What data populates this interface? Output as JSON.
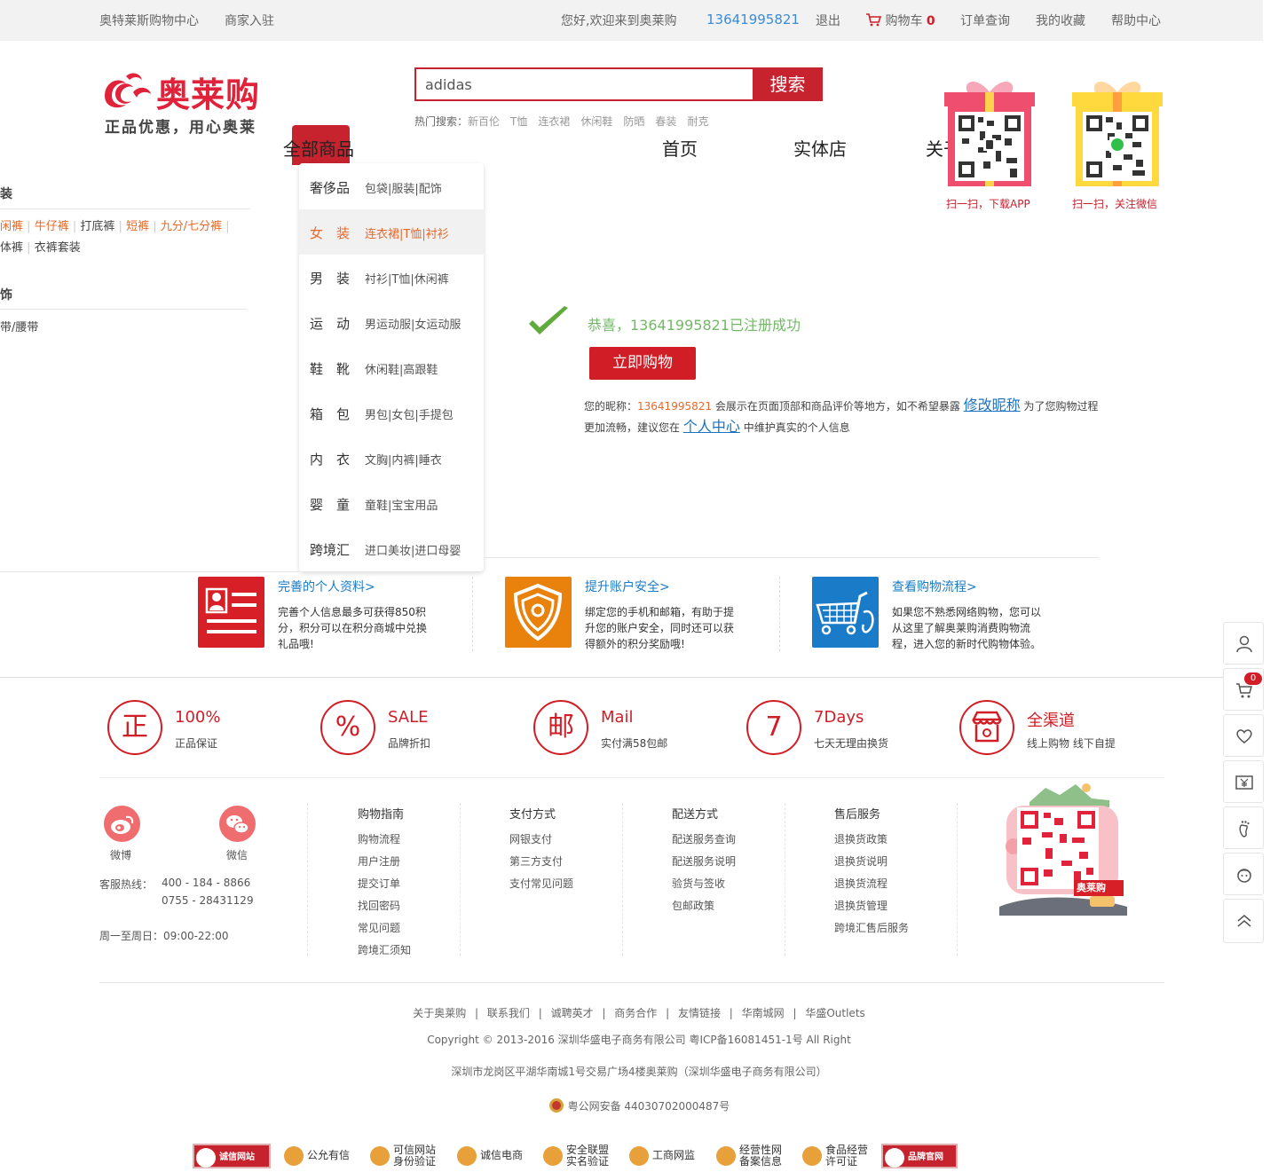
{
  "topbar": {
    "mall_center": "奥特莱斯购物中心",
    "merchant_join": "商家入驻",
    "welcome": "您好,欢迎来到奥莱购",
    "phone": "13641995821",
    "logout": "退出",
    "cart": "购物车",
    "cart_count": "0",
    "order_query": "订单查询",
    "favorites": "我的收藏",
    "help": "帮助中心"
  },
  "header": {
    "logo_text": "奥莱购",
    "slogan": "正品优惠，用心奥莱",
    "search_value": "adidas",
    "search_button": "搜索",
    "hot_label": "热门搜索：",
    "hot_terms": [
      "新百伦",
      "T恤",
      "连衣裙",
      "休闲鞋",
      "防晒",
      "春装",
      "耐克"
    ],
    "qr_app_caption": "扫一扫，下载APP",
    "qr_wechat_caption": "扫一扫，关注微信"
  },
  "nav": {
    "all_goods": "全部商品",
    "home": "首页",
    "stores": "实体店",
    "about": "关于我们"
  },
  "categories": [
    {
      "name": "奢侈品",
      "sub": "包袋|服装|配饰",
      "active": false
    },
    {
      "name": "女　装",
      "sub": "连衣裙|T恤|衬衫",
      "active": true
    },
    {
      "name": "男　装",
      "sub": "衬衫|T恤|休闲裤",
      "active": false
    },
    {
      "name": "运　动",
      "sub": "男运动服|女运动服",
      "active": false
    },
    {
      "name": "鞋　靴",
      "sub": "休闲鞋|高跟鞋",
      "active": false
    },
    {
      "name": "箱　包",
      "sub": "男包|女包|手提包",
      "active": false
    },
    {
      "name": "内　衣",
      "sub": "文胸|内裤|睡衣",
      "active": false
    },
    {
      "name": "婴　童",
      "sub": "童鞋|宝宝用品",
      "active": false
    },
    {
      "name": "跨境汇",
      "sub": "进口美妆|进口母婴",
      "active": false
    }
  ],
  "left_fragments": {
    "heading1": "装",
    "row1": [
      "闲裤",
      "牛仔裤",
      "打底裤",
      "短裤",
      "九分/七分裤"
    ],
    "row2": [
      "体裤",
      "衣裤套装"
    ],
    "heading2": "饰",
    "row3": "带/腰带"
  },
  "success": {
    "message": "恭喜，13641995821已注册成功",
    "buy_button": "立即购物",
    "nick_label": "您的昵称：",
    "nickname": "13641995821",
    "nick_desc": "会展示在页面顶部和商品评价等地方，如不希望暴露",
    "edit_nick": "修改昵称",
    "nick_desc2": "为了您购物过程",
    "line2_a": "更加流畅，建议您在",
    "personal_center": "个人中心",
    "line2_b": "中维护真实的个人信息"
  },
  "tips": [
    {
      "title": "完善的个人资料>",
      "desc": "完善个人信息最多可获得850积分，积分可以在积分商城中兑换礼品哦!",
      "color": "#d61f26"
    },
    {
      "title": "提升账户安全>",
      "desc": "绑定您的手机和邮箱，有助于提升您的账户安全，同时还可以获得额外的积分奖励哦!",
      "color": "#e9820c"
    },
    {
      "title": "查看购物流程>",
      "desc": "如果您不熟悉网络购物，您可以从这里了解奥莱购消费购物流程，进入您的新时代购物体验。",
      "color": "#1a7bc8"
    }
  ],
  "guarantees": [
    {
      "icon": "正",
      "title": "100%",
      "sub": "正品保证"
    },
    {
      "icon": "%",
      "title": "SALE",
      "sub": "品牌折扣"
    },
    {
      "icon": "邮",
      "title": "Mail",
      "sub": "实付满58包邮"
    },
    {
      "icon": "7",
      "title": "7Days",
      "sub": "七天无理由换货"
    },
    {
      "icon": "store",
      "title": "全渠道",
      "sub": "线上购物 线下自提"
    }
  ],
  "footer": {
    "weibo": "微博",
    "wechat": "微信",
    "hotline_label": "客服热线：",
    "hotline1": "400 - 184 - 8866",
    "hotline2": "0755 - 28431129",
    "hours": "周一至周日：09:00-22:00",
    "columns": [
      {
        "title": "购物指南",
        "links": [
          "购物流程",
          "用户注册",
          "提交订单",
          "找回密码",
          "常见问题",
          "跨境汇须知"
        ]
      },
      {
        "title": "支付方式",
        "links": [
          "网银支付",
          "第三方支付",
          "支付常见问题"
        ]
      },
      {
        "title": "配送方式",
        "links": [
          "配送服务查询",
          "配送服务说明",
          "验货与签收",
          "包邮政策"
        ]
      },
      {
        "title": "售后服务",
        "links": [
          "退换货政策",
          "退换货说明",
          "退换货流程",
          "退换货管理",
          "跨境汇售后服务"
        ]
      }
    ],
    "bottom_links": [
      "关于奥莱购",
      "联系我们",
      "诚聘英才",
      "商务合作",
      "友情链接",
      "华南城网",
      "华盛Outlets"
    ],
    "copyright": "Copyright © 2013-2016 深圳华盛电子商务有限公司 粤ICP备16081451-1号 All Right",
    "address": "深圳市龙岗区平湖华南城1号交易广场4楼奥莱购（深圳华盛电子商务有限公司）",
    "police": "粤公网安备 44030702000487号",
    "qr_brand": "奥莱购"
  },
  "badges": [
    {
      "label": "诚信网站",
      "style": "red"
    },
    {
      "label": "公允有信",
      "style": "plain"
    },
    {
      "label": "可信网站\n身份验证",
      "style": "plain"
    },
    {
      "label": "诚信电商",
      "style": "plain"
    },
    {
      "label": "安全联盟\n实名验证",
      "style": "plain"
    },
    {
      "label": "工商网监",
      "style": "plain"
    },
    {
      "label": "经营性网\n备案信息",
      "style": "plain"
    },
    {
      "label": "食品经营\n许可证",
      "style": "plain"
    },
    {
      "label": "品牌官网",
      "style": "red"
    }
  ],
  "sidebar": {
    "cart_count": "0"
  },
  "colors": {
    "brand_red": "#c7232f",
    "success_green": "#73b867",
    "link_blue": "#1a72c2",
    "accent_orange": "#e8682a"
  }
}
